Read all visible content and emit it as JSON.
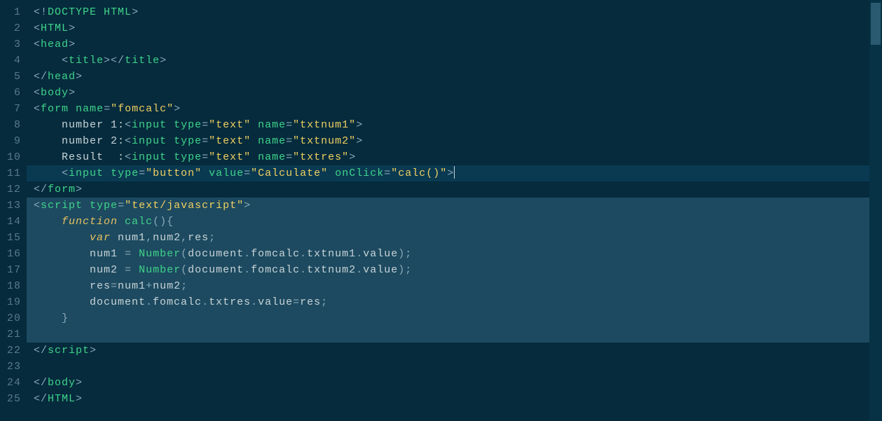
{
  "editor": {
    "gutter": [
      "1",
      "2",
      "3",
      "4",
      "5",
      "6",
      "7",
      "8",
      "9",
      "10",
      "11",
      "12",
      "13",
      "14",
      "15",
      "16",
      "17",
      "18",
      "19",
      "20",
      "21",
      "22",
      "23",
      "24",
      "25"
    ],
    "highlighted_line_index": 10,
    "selection_start_index": 12,
    "selection_end_index": 20,
    "lines": [
      {
        "t": [
          {
            "c": "pun",
            "s": "<!"
          },
          {
            "c": "tag",
            "s": "DOCTYPE"
          },
          {
            "c": "txt",
            "s": " "
          },
          {
            "c": "attr",
            "s": "HTML"
          },
          {
            "c": "pun",
            "s": ">"
          }
        ]
      },
      {
        "t": [
          {
            "c": "pun",
            "s": "<"
          },
          {
            "c": "tag",
            "s": "HTML"
          },
          {
            "c": "pun",
            "s": ">"
          }
        ]
      },
      {
        "t": [
          {
            "c": "pun",
            "s": "<"
          },
          {
            "c": "tag",
            "s": "head"
          },
          {
            "c": "pun",
            "s": ">"
          }
        ]
      },
      {
        "indent": 1,
        "t": [
          {
            "c": "pun",
            "s": "<"
          },
          {
            "c": "tag",
            "s": "title"
          },
          {
            "c": "pun",
            "s": "></"
          },
          {
            "c": "tag",
            "s": "title"
          },
          {
            "c": "pun",
            "s": ">"
          }
        ]
      },
      {
        "t": [
          {
            "c": "pun",
            "s": "</"
          },
          {
            "c": "tag",
            "s": "head"
          },
          {
            "c": "pun",
            "s": ">"
          }
        ]
      },
      {
        "t": [
          {
            "c": "pun",
            "s": "<"
          },
          {
            "c": "tag",
            "s": "body"
          },
          {
            "c": "pun",
            "s": ">"
          }
        ]
      },
      {
        "t": [
          {
            "c": "pun",
            "s": "<"
          },
          {
            "c": "tag",
            "s": "form"
          },
          {
            "c": "txt",
            "s": " "
          },
          {
            "c": "attr",
            "s": "name"
          },
          {
            "c": "pun",
            "s": "="
          },
          {
            "c": "str",
            "s": "\"fomcalc\""
          },
          {
            "c": "pun",
            "s": ">"
          }
        ]
      },
      {
        "indent": 1,
        "t": [
          {
            "c": "txt",
            "s": "number 1:"
          },
          {
            "c": "pun",
            "s": "<"
          },
          {
            "c": "tag",
            "s": "input"
          },
          {
            "c": "txt",
            "s": " "
          },
          {
            "c": "attr",
            "s": "type"
          },
          {
            "c": "pun",
            "s": "="
          },
          {
            "c": "str",
            "s": "\"text\""
          },
          {
            "c": "txt",
            "s": " "
          },
          {
            "c": "attr",
            "s": "name"
          },
          {
            "c": "pun",
            "s": "="
          },
          {
            "c": "str",
            "s": "\"txtnum1\""
          },
          {
            "c": "pun",
            "s": ">"
          }
        ]
      },
      {
        "indent": 1,
        "t": [
          {
            "c": "txt",
            "s": "number 2:"
          },
          {
            "c": "pun",
            "s": "<"
          },
          {
            "c": "tag",
            "s": "input"
          },
          {
            "c": "txt",
            "s": " "
          },
          {
            "c": "attr",
            "s": "type"
          },
          {
            "c": "pun",
            "s": "="
          },
          {
            "c": "str",
            "s": "\"text\""
          },
          {
            "c": "txt",
            "s": " "
          },
          {
            "c": "attr",
            "s": "name"
          },
          {
            "c": "pun",
            "s": "="
          },
          {
            "c": "str",
            "s": "\"txtnum2\""
          },
          {
            "c": "pun",
            "s": ">"
          }
        ]
      },
      {
        "indent": 1,
        "t": [
          {
            "c": "txt",
            "s": "Result  :"
          },
          {
            "c": "pun",
            "s": "<"
          },
          {
            "c": "tag",
            "s": "input"
          },
          {
            "c": "txt",
            "s": " "
          },
          {
            "c": "attr",
            "s": "type"
          },
          {
            "c": "pun",
            "s": "="
          },
          {
            "c": "str",
            "s": "\"text\""
          },
          {
            "c": "txt",
            "s": " "
          },
          {
            "c": "attr",
            "s": "name"
          },
          {
            "c": "pun",
            "s": "="
          },
          {
            "c": "str",
            "s": "\"txtres\""
          },
          {
            "c": "pun",
            "s": ">"
          }
        ]
      },
      {
        "indent": 1,
        "t": [
          {
            "c": "pun",
            "s": "<"
          },
          {
            "c": "tag",
            "s": "input"
          },
          {
            "c": "txt",
            "s": " "
          },
          {
            "c": "attr",
            "s": "type"
          },
          {
            "c": "pun",
            "s": "="
          },
          {
            "c": "str",
            "s": "\"button\""
          },
          {
            "c": "txt",
            "s": " "
          },
          {
            "c": "attr",
            "s": "value"
          },
          {
            "c": "pun",
            "s": "="
          },
          {
            "c": "str",
            "s": "\"Calculate\""
          },
          {
            "c": "txt",
            "s": " "
          },
          {
            "c": "attr",
            "s": "onClick"
          },
          {
            "c": "pun",
            "s": "="
          },
          {
            "c": "str",
            "s": "\"calc()\""
          },
          {
            "c": "pun",
            "s": ">"
          }
        ],
        "cursor": true
      },
      {
        "t": [
          {
            "c": "pun",
            "s": "</"
          },
          {
            "c": "tag",
            "s": "form"
          },
          {
            "c": "pun",
            "s": ">"
          }
        ]
      },
      {
        "t": [
          {
            "c": "pun",
            "s": "<"
          },
          {
            "c": "tag",
            "s": "script"
          },
          {
            "c": "txt",
            "s": " "
          },
          {
            "c": "attr",
            "s": "type"
          },
          {
            "c": "pun",
            "s": "="
          },
          {
            "c": "str",
            "s": "\"text/javascript\""
          },
          {
            "c": "pun",
            "s": ">"
          }
        ]
      },
      {
        "indent": 1,
        "t": [
          {
            "c": "kw",
            "s": "function"
          },
          {
            "c": "txt",
            "s": " "
          },
          {
            "c": "fn",
            "s": "calc"
          },
          {
            "c": "pun",
            "s": "(){"
          }
        ]
      },
      {
        "indent": 2,
        "t": [
          {
            "c": "kw",
            "s": "var"
          },
          {
            "c": "txt",
            "s": " "
          },
          {
            "c": "var",
            "s": "num1"
          },
          {
            "c": "pun",
            "s": ","
          },
          {
            "c": "var",
            "s": "num2"
          },
          {
            "c": "pun",
            "s": ","
          },
          {
            "c": "var",
            "s": "res"
          },
          {
            "c": "pun",
            "s": ";"
          }
        ]
      },
      {
        "indent": 2,
        "t": [
          {
            "c": "var",
            "s": "num1"
          },
          {
            "c": "txt",
            "s": " "
          },
          {
            "c": "op",
            "s": "="
          },
          {
            "c": "txt",
            "s": " "
          },
          {
            "c": "fn",
            "s": "Number"
          },
          {
            "c": "pun",
            "s": "("
          },
          {
            "c": "var",
            "s": "document"
          },
          {
            "c": "pun",
            "s": "."
          },
          {
            "c": "var",
            "s": "fomcalc"
          },
          {
            "c": "pun",
            "s": "."
          },
          {
            "c": "var",
            "s": "txtnum1"
          },
          {
            "c": "pun",
            "s": "."
          },
          {
            "c": "var",
            "s": "value"
          },
          {
            "c": "pun",
            "s": ");"
          }
        ]
      },
      {
        "indent": 2,
        "t": [
          {
            "c": "var",
            "s": "num2"
          },
          {
            "c": "txt",
            "s": " "
          },
          {
            "c": "op",
            "s": "="
          },
          {
            "c": "txt",
            "s": " "
          },
          {
            "c": "fn",
            "s": "Number"
          },
          {
            "c": "pun",
            "s": "("
          },
          {
            "c": "var",
            "s": "document"
          },
          {
            "c": "pun",
            "s": "."
          },
          {
            "c": "var",
            "s": "fomcalc"
          },
          {
            "c": "pun",
            "s": "."
          },
          {
            "c": "var",
            "s": "txtnum2"
          },
          {
            "c": "pun",
            "s": "."
          },
          {
            "c": "var",
            "s": "value"
          },
          {
            "c": "pun",
            "s": ");"
          }
        ]
      },
      {
        "indent": 2,
        "t": [
          {
            "c": "var",
            "s": "res"
          },
          {
            "c": "op",
            "s": "="
          },
          {
            "c": "var",
            "s": "num1"
          },
          {
            "c": "op",
            "s": "+"
          },
          {
            "c": "var",
            "s": "num2"
          },
          {
            "c": "pun",
            "s": ";"
          }
        ]
      },
      {
        "indent": 2,
        "t": [
          {
            "c": "var",
            "s": "document"
          },
          {
            "c": "pun",
            "s": "."
          },
          {
            "c": "var",
            "s": "fomcalc"
          },
          {
            "c": "pun",
            "s": "."
          },
          {
            "c": "var",
            "s": "txtres"
          },
          {
            "c": "pun",
            "s": "."
          },
          {
            "c": "var",
            "s": "value"
          },
          {
            "c": "op",
            "s": "="
          },
          {
            "c": "var",
            "s": "res"
          },
          {
            "c": "pun",
            "s": ";"
          }
        ]
      },
      {
        "indent": 1,
        "t": [
          {
            "c": "pun",
            "s": "}"
          }
        ]
      },
      {
        "t": []
      },
      {
        "t": [
          {
            "c": "pun",
            "s": "</"
          },
          {
            "c": "tag",
            "s": "script"
          },
          {
            "c": "pun",
            "s": ">"
          }
        ]
      },
      {
        "t": []
      },
      {
        "t": [
          {
            "c": "pun",
            "s": "</"
          },
          {
            "c": "tag",
            "s": "body"
          },
          {
            "c": "pun",
            "s": ">"
          }
        ]
      },
      {
        "t": [
          {
            "c": "pun",
            "s": "</"
          },
          {
            "c": "tag",
            "s": "HTML"
          },
          {
            "c": "pun",
            "s": ">"
          }
        ]
      }
    ]
  }
}
